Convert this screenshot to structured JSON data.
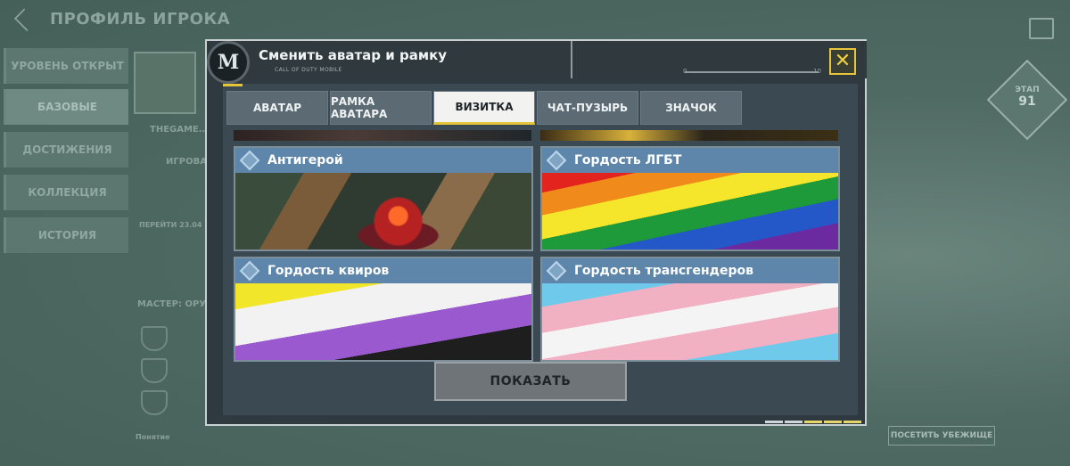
{
  "background": {
    "title": "ПРОФИЛЬ ИГРОКА",
    "side_menu": [
      {
        "label": "УРОВЕНЬ ОТКРЫТ",
        "active": false
      },
      {
        "label": "БАЗОВЫЕ",
        "active": true
      },
      {
        "label": "ДОСТИЖЕНИЯ",
        "active": false
      },
      {
        "label": "КОЛЛЕКЦИЯ",
        "active": false
      },
      {
        "label": "ИСТОРИЯ",
        "active": false
      }
    ],
    "player_name": "THEGAME...",
    "game_id_label": "ИГРОВАЯ И...",
    "small_text": "ПЕРЕЙТИ 23.04",
    "weapon_master_label": "МАСТЕР: ОРУЖИЕ",
    "bottom_label": "Понятие",
    "level_label": "ЭТАП",
    "level_value": "91",
    "visit_button": "ПОСЕТИТЬ УБЕЖИЩЕ"
  },
  "modal": {
    "title": "Сменить аватар и рамку",
    "subtitle": "CALL OF DUTY MOBILE",
    "logo": "M",
    "scale_left": "0",
    "scale_right": "10",
    "close_icon": "close-icon",
    "tabs": [
      {
        "label": "АВАТАР",
        "active": false
      },
      {
        "label": "РАМКА АВАТАРА",
        "active": false
      },
      {
        "label": "ВИЗИТКА",
        "active": true
      },
      {
        "label": "ЧАТ-ПУЗЫРЬ",
        "active": false
      },
      {
        "label": "ЗНАЧОК",
        "active": false
      }
    ],
    "cards": [
      {
        "label": "Антигерой",
        "art": "antihero"
      },
      {
        "label": "Гордость ЛГБТ",
        "art": "lgbt"
      },
      {
        "label": "Гордость квиров",
        "art": "queer"
      },
      {
        "label": "Гордость трансгендеров",
        "art": "trans"
      }
    ],
    "show_button": "ПОКАЗАТЬ"
  },
  "colors": {
    "accent": "#e6c53a",
    "card_label": "#5d86aa",
    "modal_bg": "#2f3a40"
  }
}
